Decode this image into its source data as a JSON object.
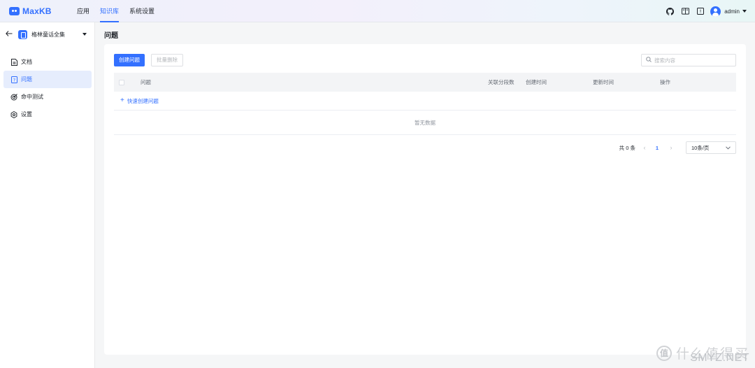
{
  "app": {
    "name": "MaxKB"
  },
  "topnav": {
    "items": [
      {
        "label": "应用"
      },
      {
        "label": "知识库"
      },
      {
        "label": "系统设置"
      }
    ],
    "active_index": 1
  },
  "user": {
    "name": "admin"
  },
  "sidebar": {
    "kb_name": "格林童话全集",
    "items": [
      {
        "label": "文档",
        "icon": "document-icon"
      },
      {
        "label": "问题",
        "icon": "question-icon"
      },
      {
        "label": "命中测试",
        "icon": "target-icon"
      },
      {
        "label": "设置",
        "icon": "settings-icon"
      }
    ],
    "active_index": 1
  },
  "main": {
    "title": "问题",
    "create_button": "创建问题",
    "batch_delete_button": "批量删除",
    "search_placeholder": "搜索内容",
    "columns": [
      "问题",
      "关联分段数",
      "创建时间",
      "更新时间",
      "操作"
    ],
    "quick_create": "快速创建问题",
    "empty_text": "暂无数据",
    "pagination": {
      "total_text": "共 0 条",
      "current_page": "1",
      "page_size": "10条/页"
    }
  },
  "colors": {
    "primary": "#3370ff",
    "active_bg": "#e6edfd",
    "page_bg": "#f5f6f7"
  },
  "watermark": {
    "badge": "值",
    "text": "什么值得买",
    "site": "SMYZ.NET"
  }
}
